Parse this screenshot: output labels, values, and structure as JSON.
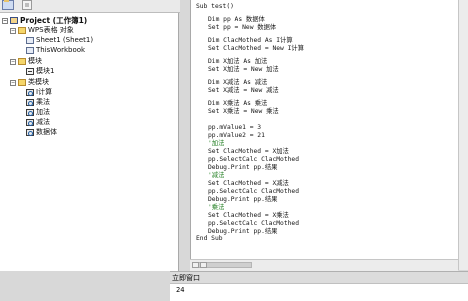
{
  "toolbar": {
    "icons": [
      "folder-icon",
      "toolbar-button-icon"
    ]
  },
  "project_tree": {
    "items": [
      {
        "label": "Project (工作簿1)",
        "toggle": "−",
        "icon": "project-icon"
      },
      {
        "label": "WPS表格 对象",
        "toggle": "−",
        "icon": "folder-icon"
      },
      {
        "label": "Sheet1 (Sheet1)",
        "icon": "sheet-icon"
      },
      {
        "label": "ThisWorkbook",
        "icon": "workbook-icon"
      },
      {
        "label": "模块",
        "toggle": "−",
        "icon": "folder-icon"
      },
      {
        "label": "模块1",
        "icon": "module-icon"
      },
      {
        "label": "类模块",
        "toggle": "−",
        "icon": "folder-icon"
      },
      {
        "label": "I计算",
        "icon": "class-module-icon"
      },
      {
        "label": "乘法",
        "icon": "class-module-icon"
      },
      {
        "label": "加法",
        "icon": "class-module-icon"
      },
      {
        "label": "减法",
        "icon": "class-module-icon"
      },
      {
        "label": "数据体",
        "icon": "class-module-icon"
      }
    ]
  },
  "code": {
    "lines": [
      {
        "text": "Sub test()",
        "indent": 0,
        "type": "code"
      },
      {
        "text": "Dim pp As 数据体",
        "indent": 1,
        "type": "code"
      },
      {
        "text": "Set pp = New 数据体",
        "indent": 1,
        "type": "code"
      },
      {
        "text": "Dim ClacMothed As I计算",
        "indent": 1,
        "type": "code"
      },
      {
        "text": "Set ClacMothed = New I计算",
        "indent": 1,
        "type": "code"
      },
      {
        "text": "Dim X加法 As 加法",
        "indent": 1,
        "type": "code"
      },
      {
        "text": "Set X加法 = New 加法",
        "indent": 1,
        "type": "code"
      },
      {
        "text": "Dim X减法 As 减法",
        "indent": 1,
        "type": "code"
      },
      {
        "text": "Set X减法 = New 减法",
        "indent": 1,
        "type": "code"
      },
      {
        "text": "Dim X乘法 As 乘法",
        "indent": 1,
        "type": "code"
      },
      {
        "text": "Set X乘法 = New 乘法",
        "indent": 1,
        "type": "code"
      },
      {
        "text": "pp.mValue1 = 3",
        "indent": 1,
        "type": "code"
      },
      {
        "text": "pp.mValue2 = 21",
        "indent": 1,
        "type": "code"
      },
      {
        "text": "'加法",
        "indent": 1,
        "type": "comment"
      },
      {
        "text": "Set ClacMothed = X加法",
        "indent": 1,
        "type": "code"
      },
      {
        "text": "pp.SelectCalc ClacMothed",
        "indent": 1,
        "type": "code"
      },
      {
        "text": "Debug.Print pp.结果",
        "indent": 1,
        "type": "code"
      },
      {
        "text": "'减法",
        "indent": 1,
        "type": "comment"
      },
      {
        "text": "Set ClacMothed = X减法",
        "indent": 1,
        "type": "code"
      },
      {
        "text": "pp.SelectCalc ClacMothed",
        "indent": 1,
        "type": "code"
      },
      {
        "text": "Debug.Print pp.结果",
        "indent": 1,
        "type": "code"
      },
      {
        "text": "'乘法",
        "indent": 1,
        "type": "comment"
      },
      {
        "text": "Set ClacMothed = X乘法",
        "indent": 1,
        "type": "code"
      },
      {
        "text": "pp.SelectCalc ClacMothed",
        "indent": 1,
        "type": "code"
      },
      {
        "text": "Debug.Print pp.结果",
        "indent": 1,
        "type": "code"
      },
      {
        "text": "End Sub",
        "indent": 0,
        "type": "code"
      }
    ]
  },
  "immediate": {
    "title": "立即窗口",
    "output": "24"
  }
}
